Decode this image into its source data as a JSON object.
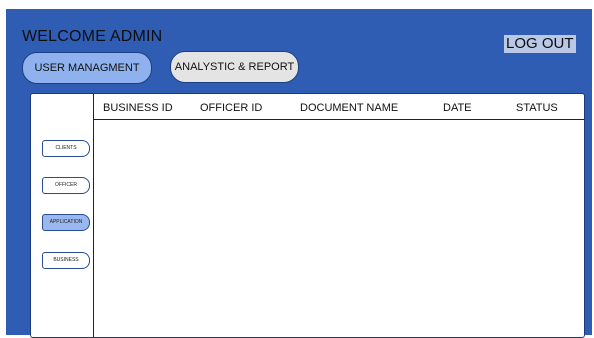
{
  "header": {
    "welcome": "WELCOME ADMIN",
    "logout_label": "LOG OUT"
  },
  "tabs": [
    {
      "label": "USER MANAGMENT",
      "active": true
    },
    {
      "label": "ANALYSTIC & REPORT",
      "active": false
    }
  ],
  "table": {
    "columns": [
      "BUSINESS ID",
      "OFFICER ID",
      "DOCUMENT NAME",
      "DATE",
      "STATUS"
    ],
    "rows": []
  },
  "sidebar": {
    "items": [
      {
        "label": "CLIENTS"
      },
      {
        "label": "OFFICER"
      },
      {
        "label": "APPLICATION",
        "active": true
      },
      {
        "label": "BUSINESS"
      }
    ]
  },
  "colors": {
    "frame": "#2f5db4",
    "active_pill": "#8fb2ee",
    "inactive_pill": "#e4e4e4",
    "active_side": "#9ab7ee"
  }
}
